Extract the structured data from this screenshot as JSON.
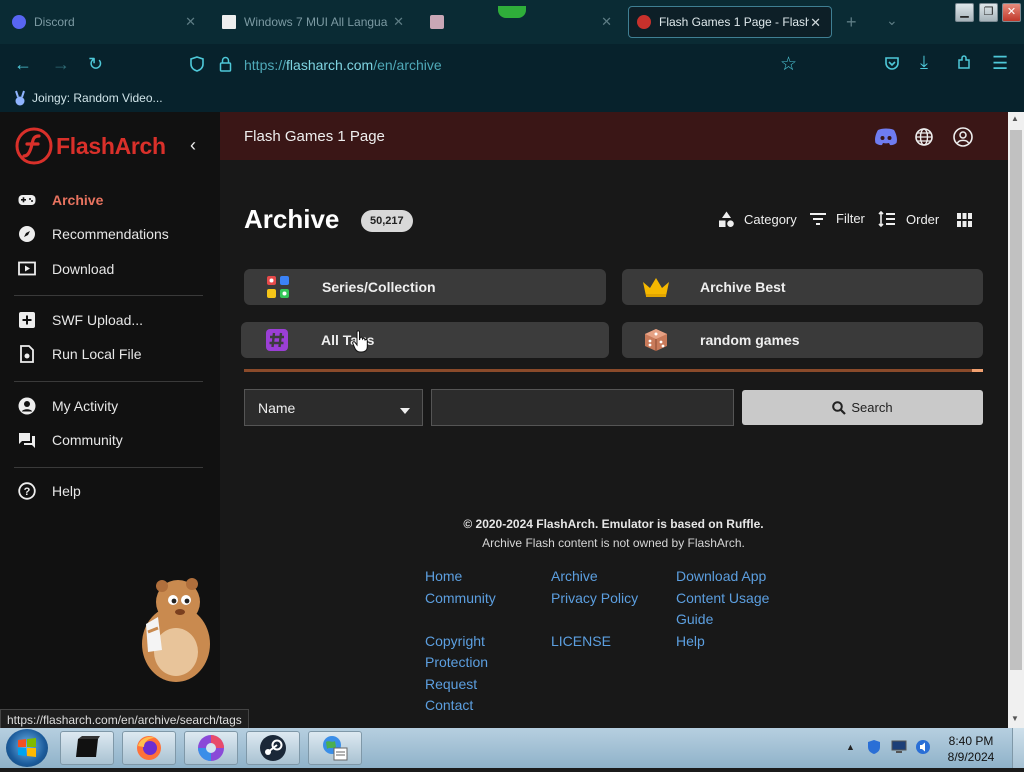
{
  "browser": {
    "tabs": [
      {
        "label": "Discord",
        "active": false
      },
      {
        "label": "Windows 7 MUI All Langua",
        "active": false
      },
      {
        "label": "",
        "active": false
      },
      {
        "label": "Flash Games 1 Page - Flash",
        "active": true
      }
    ],
    "new_tab_icon": "plus-icon",
    "url_prefix": "https://",
    "url_host": "flasharch.com",
    "url_path": "/en/archive",
    "bookmark": "Joingy: Random Video..."
  },
  "sidebar": {
    "brand": "FlashArch",
    "items": [
      {
        "label": "Archive",
        "icon": "gamepad-icon"
      },
      {
        "label": "Recommendations",
        "icon": "compass-icon"
      },
      {
        "label": "Download",
        "icon": "play-box-icon"
      },
      {
        "label": "SWF Upload...",
        "icon": "plus-box-icon"
      },
      {
        "label": "Run Local File",
        "icon": "file-icon"
      },
      {
        "label": "My Activity",
        "icon": "user-icon"
      },
      {
        "label": "Community",
        "icon": "chat-icon"
      },
      {
        "label": "Help",
        "icon": "help-icon"
      }
    ]
  },
  "header": {
    "page_title": "Flash Games 1 Page"
  },
  "archive": {
    "title": "Archive",
    "count": "50,217",
    "tools": {
      "category": "Category",
      "filter": "Filter",
      "order": "Order"
    },
    "cards": [
      "Series/Collection",
      "Archive Best",
      "All Tags",
      "random games"
    ],
    "select_value": "Name",
    "search_label": "Search"
  },
  "footer": {
    "copyright": "© 2020-2024 FlashArch. Emulator is based on Ruffle.",
    "notice": "Archive Flash content is not owned by FlashArch.",
    "col1": [
      "Home",
      "Community",
      "",
      "Copyright",
      "Protection",
      "Request",
      "Contact"
    ],
    "col2": [
      "Archive",
      "Privacy Policy",
      "",
      "LICENSE"
    ],
    "col3": [
      "Download App",
      "Content Usage",
      "Guide",
      "Help"
    ]
  },
  "status_url": "https://flasharch.com/en/archive/search/tags",
  "clock": {
    "time": "8:40 PM",
    "date": "8/9/2024"
  },
  "colors": {
    "accent": "#e8735f",
    "link": "#5c9fe0",
    "header_band": "#3a1616"
  }
}
